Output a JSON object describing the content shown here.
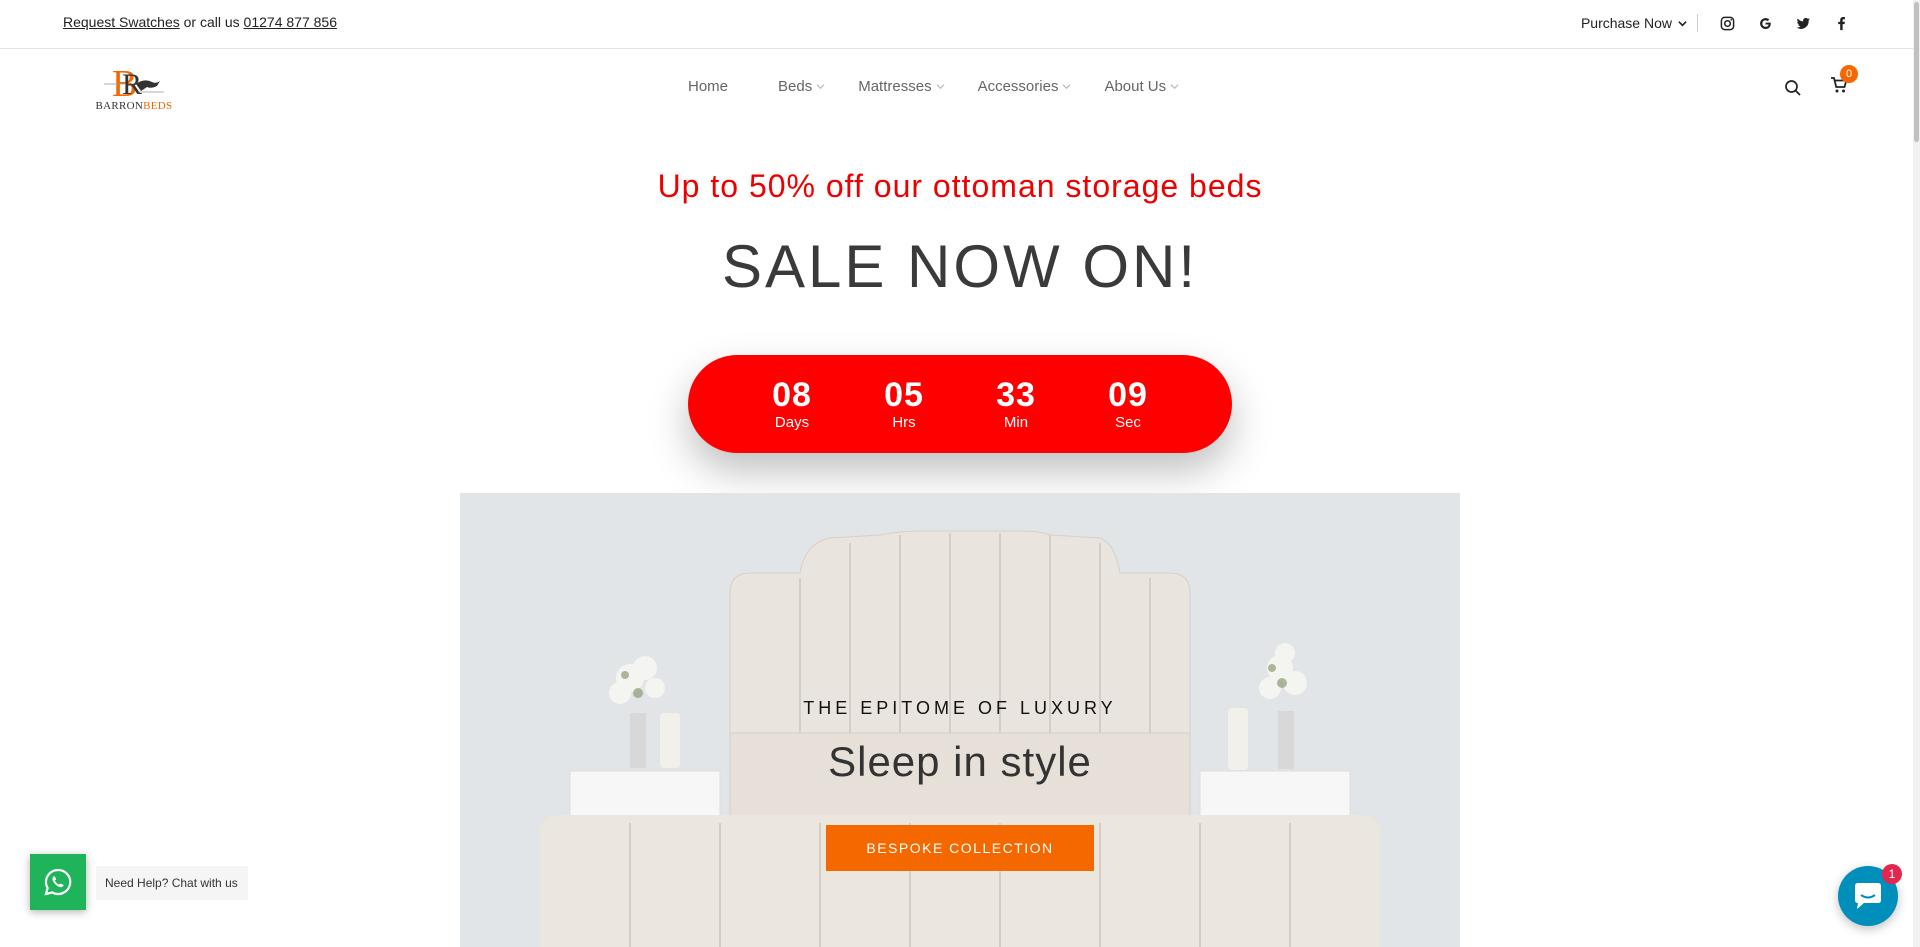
{
  "topbar": {
    "request_swatches": "Request Swatches",
    "or_call": " or call us ",
    "phone": "01274 877 856",
    "purchase_now": "Purchase Now",
    "social_icons": [
      "instagram-icon",
      "google-icon",
      "twitter-icon",
      "facebook-icon"
    ]
  },
  "header": {
    "logo_text_1": "BARRON",
    "logo_text_2": "BEDS",
    "nav": [
      {
        "label": "Home",
        "dropdown": false
      },
      {
        "label": "Beds",
        "dropdown": true
      },
      {
        "label": "Mattresses",
        "dropdown": true
      },
      {
        "label": "Accessories",
        "dropdown": true
      },
      {
        "label": "About Us",
        "dropdown": true
      }
    ],
    "cart_count": "0"
  },
  "promo": {
    "subtitle": "Up to 50% off our ottoman storage beds",
    "title": "SALE NOW ON!"
  },
  "countdown": {
    "days": "08",
    "days_label": "Days",
    "hours": "05",
    "hours_label": "Hrs",
    "minutes": "33",
    "minutes_label": "Min",
    "seconds": "09",
    "seconds_label": "Sec"
  },
  "hero": {
    "kicker": "THE EPITOME OF LUXURY",
    "title": "Sleep in style",
    "button": "BESPOKE COLLECTION"
  },
  "chat": {
    "whatsapp_text": "Need Help? Chat with us",
    "shop_badge": "1"
  },
  "colors": {
    "accent": "#f56800",
    "sale_red": "#fe0000",
    "whatsapp": "#1fb35a",
    "shop_chat": "#008ebb"
  }
}
